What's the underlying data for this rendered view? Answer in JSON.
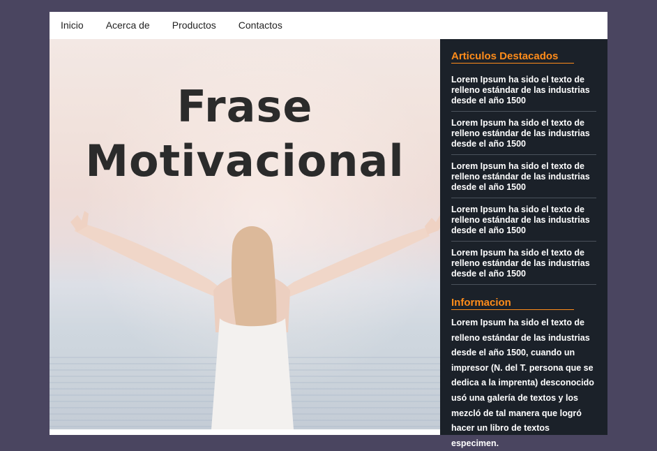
{
  "nav": {
    "items": [
      "Inicio",
      "Acerca de",
      "Productos",
      "Contactos"
    ]
  },
  "hero": {
    "title_line1": "Frase",
    "title_line2": "Motivacional"
  },
  "sidebar": {
    "featured_heading": "Articulos Destacados",
    "articles": [
      "Lorem Ipsum ha sido el texto de relleno estándar de las industrias desde el año 1500",
      "Lorem Ipsum ha sido el texto de relleno estándar de las industrias desde el año 1500",
      "Lorem Ipsum ha sido el texto de relleno estándar de las industrias desde el año 1500",
      "Lorem Ipsum ha sido el texto de relleno estándar de las industrias desde el año 1500",
      "Lorem Ipsum ha sido el texto de relleno estándar de las industrias desde el año 1500"
    ],
    "info_heading": "Informacion",
    "info_text": "Lorem Ipsum ha sido el texto de relleno estándar de las industrias desde el año 1500, cuando un impresor (N. del T. persona que se dedica a la imprenta) desconocido usó una galería de textos y los mezcló de tal manera que logró hacer un libro de textos especimen."
  },
  "colors": {
    "background": "#4a4560",
    "sidebar": "#1b2129",
    "accent": "#ff8c1a"
  }
}
